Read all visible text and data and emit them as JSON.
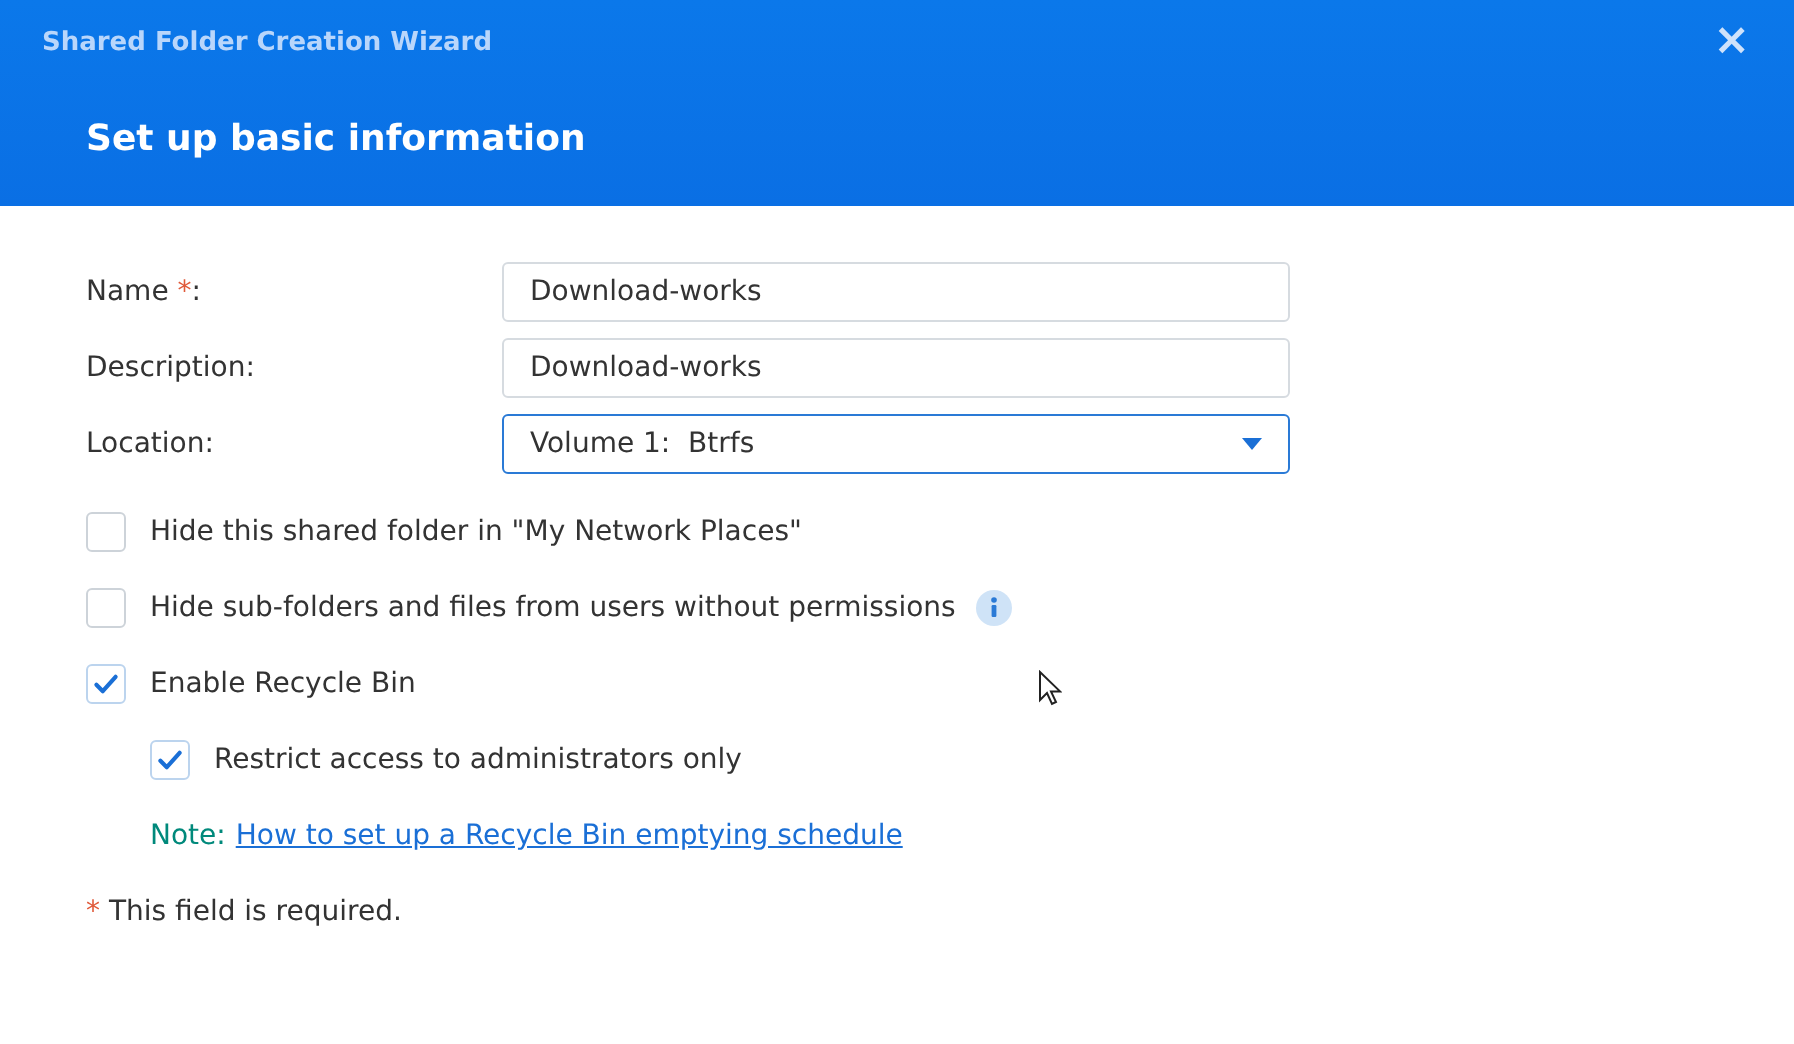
{
  "window": {
    "title": "Shared Folder Creation Wizard",
    "close": "×"
  },
  "step_title": "Set up basic information",
  "fields": [
    {
      "kind": "text",
      "label": "Name",
      "required_mark": "*",
      "suffix": ":",
      "value": "Download-works"
    },
    {
      "kind": "text",
      "label": "Description:",
      "value": "Download-works"
    },
    {
      "kind": "select",
      "label": "Location:",
      "value": "Volume 1:  Btrfs",
      "focused": true
    }
  ],
  "options": [
    {
      "label": "Hide this shared folder in \"My Network Places\"",
      "checked": false
    },
    {
      "label": "Hide sub-folders and files from users without permissions",
      "checked": false,
      "info": true
    },
    {
      "label": "Enable Recycle Bin",
      "checked": true,
      "children": [
        {
          "label": "Restrict access to administrators only",
          "checked": true
        }
      ],
      "note": {
        "label": "Note:",
        "link": "How to set up a Recycle Bin emptying schedule"
      }
    }
  ],
  "footnote": {
    "mark": "*",
    "text": "This field is required."
  }
}
